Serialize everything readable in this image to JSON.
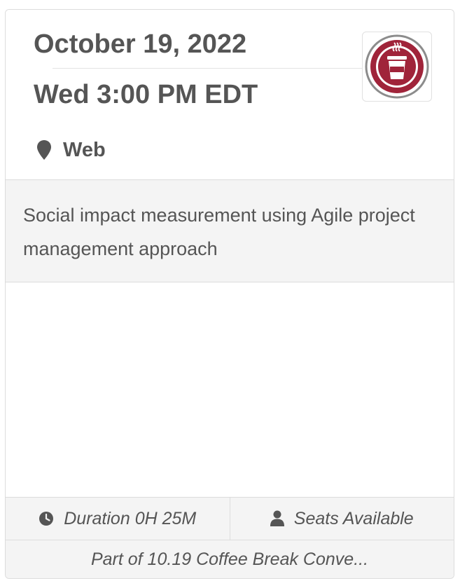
{
  "event": {
    "date": "October 19, 2022",
    "time": "Wed 3:00 PM EDT",
    "location": "Web",
    "location_icon": "map-marker-icon",
    "logo_icon": "coffee-cup-icon",
    "description": "Social impact measurement using Agile project management approach",
    "duration_label": "Duration 0H 25M",
    "duration_icon": "clock-icon",
    "seats_label": "Seats Available",
    "seats_icon": "user-icon",
    "series_link": "Part of 10.19 Coffee Break Conve..."
  },
  "colors": {
    "text": "#555555",
    "brand": "#a0243a",
    "panel": "#f4f4f4",
    "border": "#dcdcdc"
  }
}
